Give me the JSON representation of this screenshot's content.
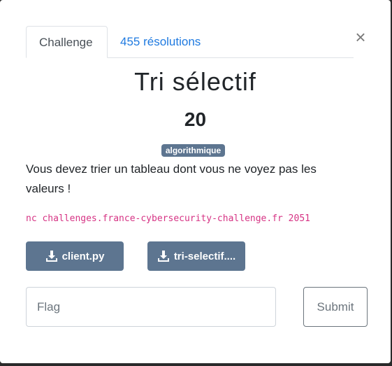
{
  "tabs": [
    {
      "label": "Challenge"
    },
    {
      "label": "455 résolutions"
    }
  ],
  "close_symbol": "×",
  "challenge": {
    "title": "Tri sélectif",
    "points": "20",
    "category": "algorithmique",
    "description": "Vous devez trier un tableau dont vous ne voyez pas les valeurs !",
    "command": "nc challenges.france-cybersecurity-challenge.fr 2051"
  },
  "files": [
    {
      "label": "client.py",
      "icon": "download-icon"
    },
    {
      "label": "tri-selectif....",
      "icon": "download-icon"
    }
  ],
  "form": {
    "flag_placeholder": "Flag",
    "submit_label": "Submit"
  },
  "colors": {
    "accent": "#1f7ae0",
    "badge": "#5d7590",
    "command_text": "#d63384"
  }
}
